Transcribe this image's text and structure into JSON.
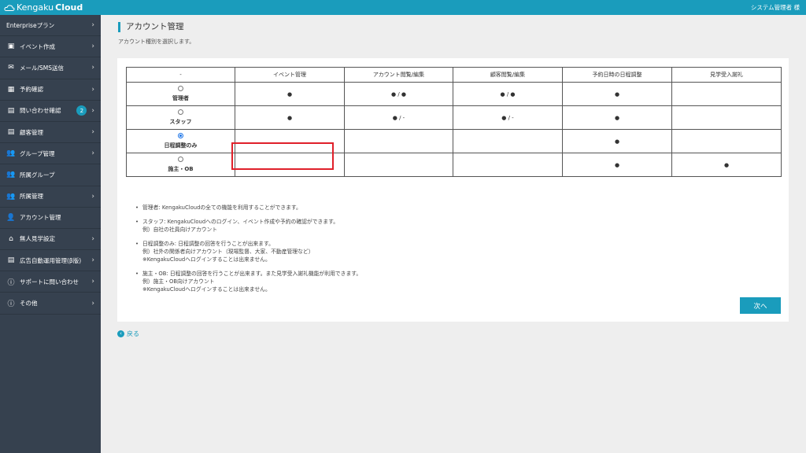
{
  "header": {
    "logo_text_a": "Kengaku",
    "logo_text_b": "Cloud",
    "user_name": "システム管理者 様"
  },
  "sidebar": {
    "items": [
      {
        "label": "Enterpriseプラン",
        "icon": "none",
        "chevron": true
      },
      {
        "label": "イベント作成",
        "icon": "image-icon",
        "chevron": true
      },
      {
        "label": "メール/SMS送信",
        "icon": "mail-icon",
        "chevron": true
      },
      {
        "label": "予約確認",
        "icon": "calendar-icon",
        "chevron": true
      },
      {
        "label": "問い合わせ確認",
        "icon": "id-card-icon",
        "chevron": true,
        "badge": "2"
      },
      {
        "label": "顧客管理",
        "icon": "id-card-icon",
        "chevron": true
      },
      {
        "label": "グループ管理",
        "icon": "users-icon",
        "chevron": true
      },
      {
        "label": "所属グループ",
        "icon": "users-icon",
        "chevron": false
      },
      {
        "label": "所属管理",
        "icon": "users-icon",
        "chevron": true
      },
      {
        "label": "アカウント管理",
        "icon": "user-gear-icon",
        "chevron": false
      },
      {
        "label": "無人見学設定",
        "icon": "home-icon",
        "chevron": true
      },
      {
        "label": "広告自動運用管理(β版)",
        "icon": "id-card-icon",
        "chevron": true
      },
      {
        "label": "サポートに問い合わせ",
        "icon": "info-icon",
        "chevron": true
      },
      {
        "label": "その他",
        "icon": "info-icon",
        "chevron": true
      }
    ]
  },
  "main": {
    "title": "アカウント管理",
    "subtitle": "アカウント種別を選択します。",
    "table": {
      "headers": [
        "-",
        "イベント管理",
        "アカウント閲覧/編集",
        "顧客閲覧/編集",
        "予約日時の日程調整",
        "見学受入謝礼"
      ],
      "rows": [
        {
          "role": "管理者",
          "selected": false,
          "cells": [
            "●",
            "● / ●",
            "● / ●",
            "●",
            ""
          ]
        },
        {
          "role": "スタッフ",
          "selected": false,
          "cells": [
            "●",
            "● / -",
            "● / -",
            "●",
            ""
          ]
        },
        {
          "role": "日程調整のみ",
          "selected": true,
          "cells": [
            "",
            "",
            "",
            "●",
            ""
          ]
        },
        {
          "role": "施主・OB",
          "selected": false,
          "cells": [
            "",
            "",
            "",
            "●",
            "●"
          ]
        }
      ]
    },
    "notes": [
      [
        "管理者: KengakuCloudの全ての機能を利用することができます。"
      ],
      [
        "スタッフ: KengakuCloudへのログイン、イベント作成や予約の確認ができます。",
        "例）自社の社員向けアカウント"
      ],
      [
        "日程調整のみ: 日程調整の回答を行うことが出来ます。",
        "例）社外の関係者向けアカウント（現場監督、大家、不動産管理など）",
        "※KengakuCloudへログインすることは出来ません。"
      ],
      [
        "施主・OB: 日程調整の回答を行うことが出来ます。また見学受入謝礼機能が利用できます。",
        "例）施主・OB向けアカウント",
        "※KengakuCloudへログインすることは出来ません。"
      ]
    ],
    "next_label": "次へ",
    "back_label": "戻る"
  },
  "colors": {
    "accent": "#1a9cbc",
    "sidebar": "#36414f",
    "highlight": "#e0202a",
    "background": "#eeeeee"
  }
}
